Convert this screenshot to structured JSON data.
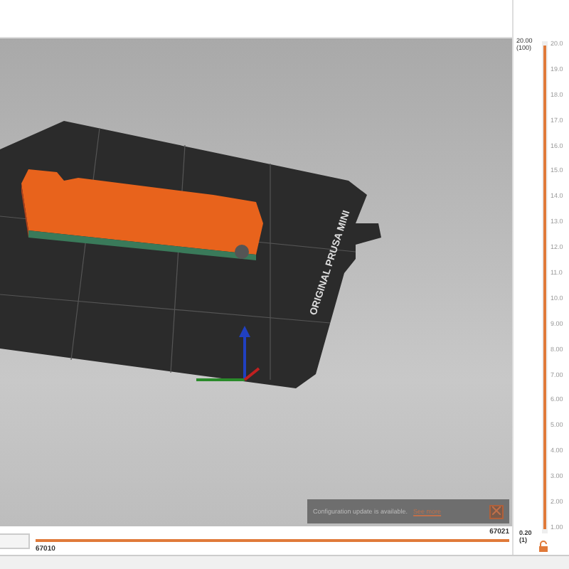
{
  "viewport": {
    "bed_label": "ORIGINAL PRUSA MINI"
  },
  "notification": {
    "message": "Configuration update is available.",
    "link": "See more"
  },
  "vertical_slider": {
    "top_value": "20.00",
    "top_layer": "(100)",
    "bottom_value": "0.20",
    "bottom_layer": "(1)",
    "level": 1,
    "ticks": [
      "20.0",
      "19.0",
      "18.0",
      "17.0",
      "16.0",
      "15.0",
      "14.0",
      "13.0",
      "12.0",
      "11.0",
      "10.0",
      "9.00",
      "8.00",
      "7.00",
      "6.00",
      "5.00",
      "4.00",
      "3.00",
      "2.00",
      "1.00"
    ]
  },
  "horizontal_slider": {
    "start": "67010",
    "end": "67021",
    "level": 1
  }
}
